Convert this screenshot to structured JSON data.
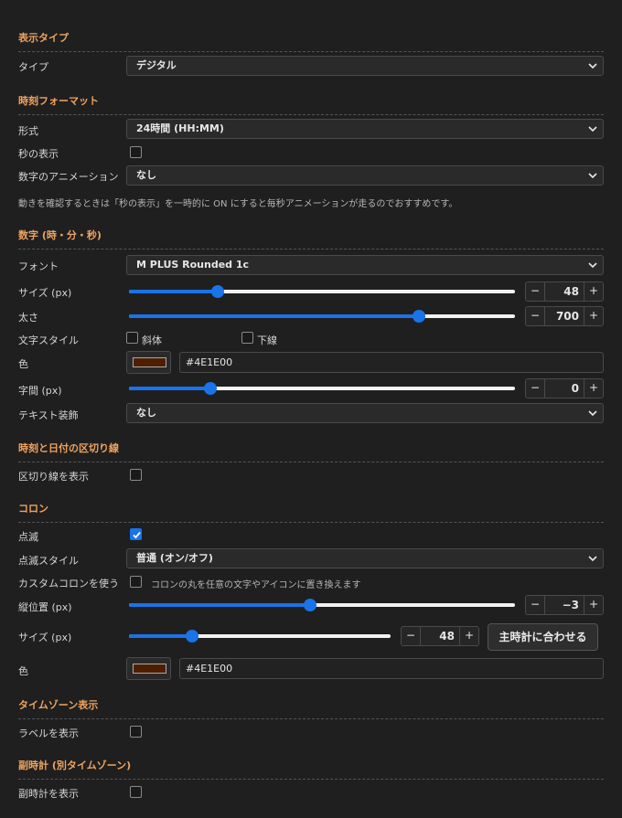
{
  "colors": {
    "accent": "#1a73e8",
    "section": "#f0a35e",
    "digit_color": "#4E1E00"
  },
  "display_type": {
    "title": "表示タイプ",
    "type_label": "タイプ",
    "type_value": "デジタル"
  },
  "time_format": {
    "title": "時刻フォーマット",
    "format_label": "形式",
    "format_value": "24時間 (HH:MM)",
    "seconds_label": "秒の表示",
    "seconds_checked": false,
    "animation_label": "数字のアニメーション",
    "animation_value": "なし",
    "hint": "動きを確認するときは「秒の表示」を一時的に ON にすると毎秒アニメーションが走るのでおすすめです。"
  },
  "digits": {
    "title": "数字 (時・分・秒)",
    "font_label": "フォント",
    "font_value": "M PLUS Rounded 1c",
    "size_label": "サイズ (px)",
    "size_value": "48",
    "size_fraction": 0.23,
    "weight_label": "太さ",
    "weight_value": "700",
    "weight_fraction": 0.75,
    "style_label": "文字スタイル",
    "italic_label": "斜体",
    "underline_label": "下線",
    "color_label": "色",
    "color_hex": "#4E1E00",
    "spacing_label": "字間 (px)",
    "spacing_value": "0",
    "spacing_fraction": 0.21,
    "decoration_label": "テキスト装飾",
    "decoration_value": "なし"
  },
  "separator": {
    "title": "時刻と日付の区切り線",
    "show_label": "区切り線を表示"
  },
  "colon": {
    "title": "コロン",
    "blink_label": "点滅",
    "blink_checked": true,
    "blink_style_label": "点滅スタイル",
    "blink_style_value": "普通 (オン/オフ)",
    "custom_label": "カスタムコロンを使う",
    "custom_note": "コロンの丸を任意の文字やアイコンに置き換えます",
    "vpos_label": "縦位置 (px)",
    "vpos_value": "−3",
    "vpos_fraction": 0.47,
    "size_label": "サイズ (px)",
    "size_value": "48",
    "size_fraction": 0.24,
    "match_button": "主時計に合わせる",
    "color_label": "色",
    "color_hex": "#4E1E00"
  },
  "timezone": {
    "title": "タイムゾーン表示",
    "label_label": "ラベルを表示"
  },
  "sub_clock": {
    "title": "副時計 (別タイムゾーン)",
    "show_label": "副時計を表示"
  }
}
